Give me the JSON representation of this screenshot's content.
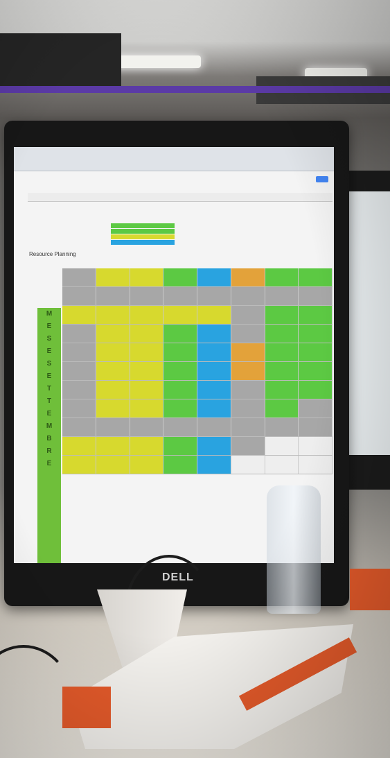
{
  "scene": {
    "monitor_logo": "DELL",
    "spreadsheet_label": "Resource Planning",
    "month_letters": [
      "M",
      "E",
      "S",
      "E",
      "",
      "S",
      "E",
      "T",
      "T",
      "E",
      "M",
      "B",
      "R",
      "E"
    ]
  },
  "colors": {
    "accent_rail": "#5b3aa6",
    "sheet_green": "#5cc943",
    "sheet_yellow": "#d7d92e",
    "sheet_blue": "#29a3e0",
    "sheet_orange": "#e3a23a",
    "sheet_grey": "#a7a7a7",
    "base_orange": "#e45a2a"
  }
}
